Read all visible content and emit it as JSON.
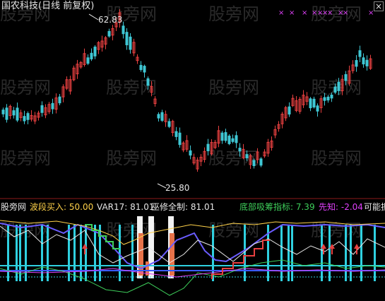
{
  "colors": {
    "background": "#000000",
    "up_candle": "#e84040",
    "down_candle": "#3fc7d4",
    "title_text": "#e6e6e6",
    "ind_yellow": "#ffd24a",
    "ind_white": "#e6e6e6",
    "ind_green": "#3ecf5b",
    "ind_magenta": "#e040fb",
    "divider": "#8b1a1a"
  },
  "chart": {
    "title": "国农科技(日线 前复权)",
    "high_label": "62.83",
    "low_label": "25.80",
    "close_label": "×"
  },
  "markers": [
    "×",
    "×",
    "×",
    "×",
    "×",
    "×",
    "×",
    "×",
    "×",
    "×"
  ],
  "indicator": {
    "panel_name": "股旁网",
    "items": [
      {
        "label": "波段买入: 50.00",
        "color_key": "ind_yellow"
      },
      {
        "label": "VAR17: 81.01",
        "color_key": "ind_white"
      },
      {
        "label": "巫修全制: 81.01",
        "color_key": "ind_white"
      },
      {
        "label": "底部吸筹指标: 7.39",
        "color_key": "ind_green"
      },
      {
        "label": "先知: -2.04",
        "color_key": "ind_magenta"
      },
      {
        "label": "可能振",
        "color_key": "ind_white"
      }
    ]
  },
  "watermark": "股旁网"
}
